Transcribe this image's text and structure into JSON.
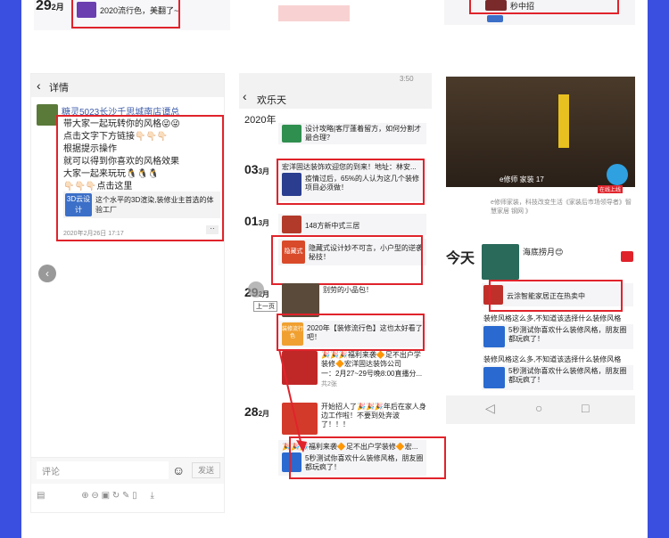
{
  "top": {
    "date_day": "29",
    "date_month": "2月",
    "post_text": "2020流行色，美翻了~",
    "icon_text": "装修\n流行色",
    "right_text": "秒中招"
  },
  "left_screen": {
    "title": "详情",
    "author": "糖灵5023长沙千思城南店谭总",
    "lines": [
      "带大家一起玩转你的风格😜😜",
      "点击文字下方链接👇🏻👇🏻👇🏻",
      "根据提示操作",
      "就可以得到你喜欢的风格效果",
      "大家一起来玩玩🐧🐧🐧",
      "👇🏻👇🏻👇🏻点击这里"
    ],
    "link_icon_text": "3D云设计",
    "link_text": "这个水平的3D渲染,装修业主首选的体验工厂",
    "timestamp": "2020年2月26日 17:17",
    "comment_placeholder": "评论",
    "send_label": "发送"
  },
  "middle_screen": {
    "status_time": "3:50",
    "title": "欢乐天",
    "year": "2020年",
    "entries": [
      {
        "day": "",
        "month": "",
        "text": "设计攻略|客厅蓬着留方，如何分割才最合理？",
        "icon": "客餐厅"
      },
      {
        "day": "03",
        "month": "3月",
        "text": "宏洋固达装饰欢迎您的到来！地址：林安...",
        "sub": "疫情过后，65%的人认为这几个装修项目必须做！",
        "icon": "装修"
      },
      {
        "day": "01",
        "month": "3月",
        "text": "148方新中式三居"
      },
      {
        "day": "",
        "month": "",
        "text": "隐藏式设计妙不可言，小户型的逆袭秘技！",
        "icon": "隐藏式"
      },
      {
        "day": "29",
        "month": "2月",
        "text": "别劳的小品包！",
        "extra": "上一页"
      },
      {
        "day": "",
        "month": "",
        "text": "2020年【装修流行色】这也太好看了吧！",
        "icon": "装修流行色"
      },
      {
        "day": "",
        "month": "",
        "text": "🎉🎉🎉福利来袭🔶足不出户学装修🔶宏洋固达装饰公司",
        "sub": "一：2月27~29号晚8:00直播分...",
        "extra": "共2张"
      },
      {
        "day": "28",
        "month": "2月",
        "text": "开始招人了🎉🎉🎉年后在家人身边工作啦！不要到处奔波了！！！"
      },
      {
        "day": "",
        "month": "",
        "text": "🎉🎉🎉福利来袭🔶足不出户学装修🔶宏...",
        "sub": "5秒测试你喜欢什么装修风格，朋友圈都玩疯了！",
        "icon": "风格测试"
      }
    ]
  },
  "right_screen": {
    "video_caption": "e修师 家装 17",
    "sub_caption": "e修师家装，科技改变生活《家装后市场领导者》智慧家居 钢网 》",
    "badge": "在线上线",
    "today": "今天",
    "post_title": "海底捞月😊",
    "entries": [
      {
        "text": "云涂智能家居正在热卖中",
        "icon": "云涂"
      },
      {
        "text": "装修风格这么多,不知道该选择什么装修风格",
        "sub": "",
        "icon": ""
      },
      {
        "text": "5秒测试你喜欢什么装修风格，朋友圈都玩疯了！",
        "icon": "风格测试"
      },
      {
        "text": "装修风格这么多,不知道该选择什么装修风格",
        "sub": "",
        "icon": ""
      },
      {
        "text": "5秒测试你喜欢什么装修风格，朋友圈都玩疯了！",
        "icon": "风格测试"
      }
    ],
    "nav": [
      "back",
      "home",
      "recent"
    ]
  },
  "colors": {
    "frame": "#3a4fe0",
    "red": "#e0232b",
    "link": "#3c5ba8"
  }
}
